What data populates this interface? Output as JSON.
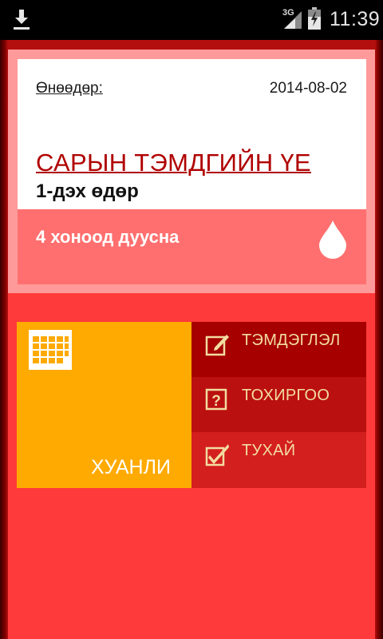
{
  "status_bar": {
    "network": "3G",
    "time": "11:39"
  },
  "header": {
    "today_label": "Өнөөдөр:",
    "date": "2014-08-02"
  },
  "period": {
    "title": "САРЫН ТЭМДГИЙН ҮЕ",
    "day": "1-дэх өдөр",
    "countdown": "4 хоноод дуусна"
  },
  "tiles": {
    "calendar_label": "ХУАНЛИ",
    "menu": [
      {
        "label": "ТЭМДЭГЛЭЛ",
        "icon": "edit-note-icon"
      },
      {
        "label": "ТОХИРГОО",
        "icon": "question-box-icon"
      },
      {
        "label": "ТУХАЙ",
        "icon": "checkbox-icon"
      }
    ]
  },
  "colors": {
    "accent_red": "#ff3a3a",
    "title_red": "#b00000",
    "calendar_tile": "#ffaa00",
    "menu_text": "#f2dca0"
  }
}
